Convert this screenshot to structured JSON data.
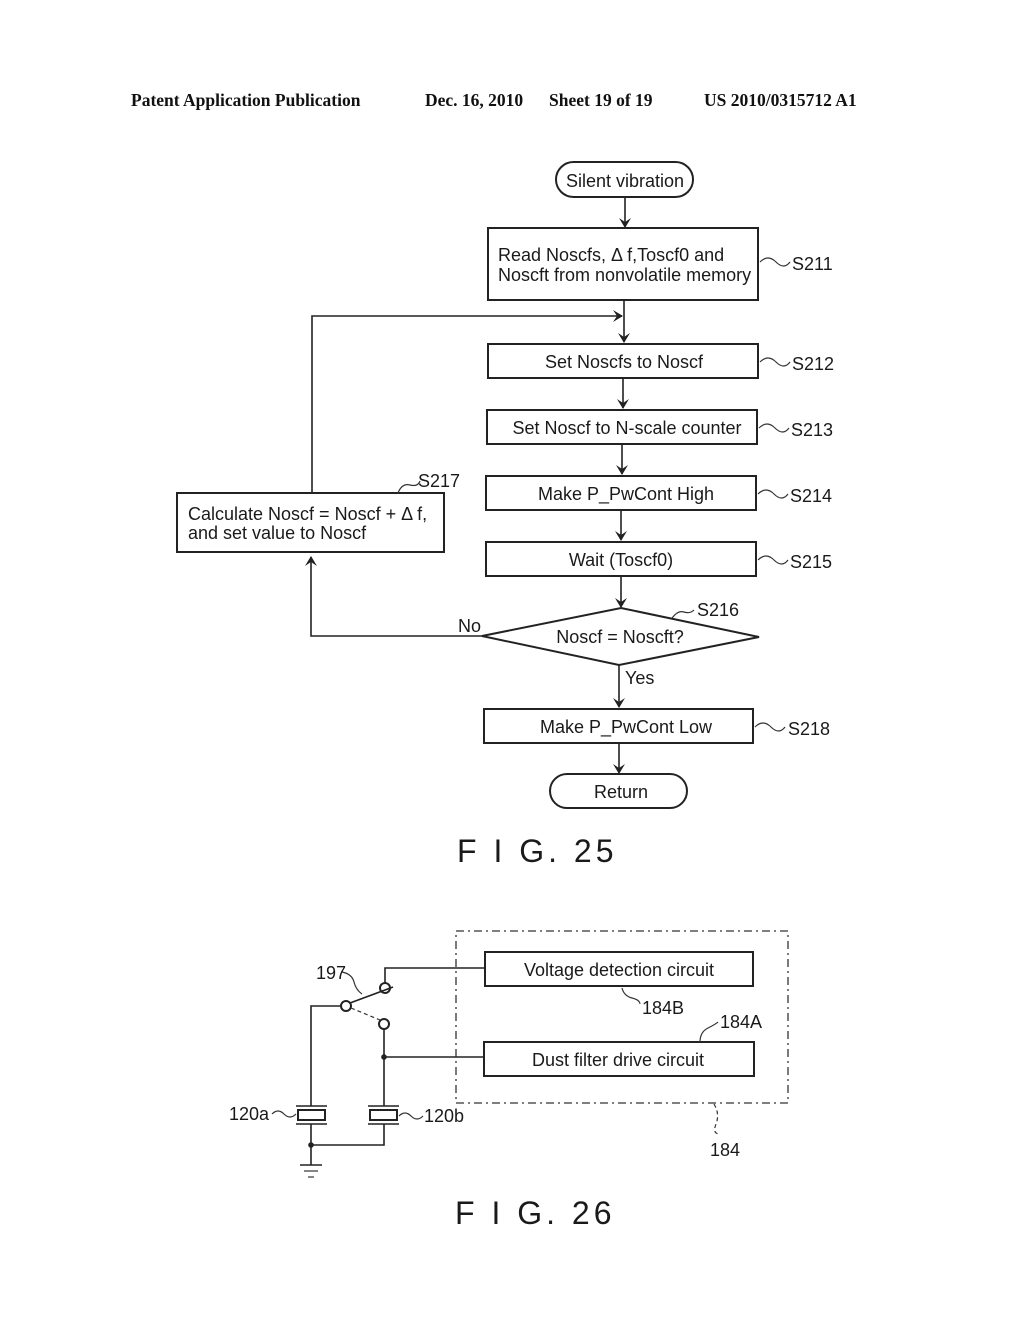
{
  "header": {
    "publication": "Patent Application Publication",
    "date": "Dec. 16, 2010",
    "sheet": "Sheet 19 of 19",
    "number": "US 2010/0315712 A1"
  },
  "fig25": {
    "caption": "F I G. 25",
    "start": "Silent vibration",
    "end": "Return",
    "steps": [
      {
        "id": "S211",
        "lines": [
          "Read Noscfs, Δ f,Toscf0 and",
          "Noscft from nonvolatile memory"
        ]
      },
      {
        "id": "S212",
        "lines": [
          "Set Noscfs to Noscf"
        ]
      },
      {
        "id": "S213",
        "lines": [
          "Set Noscf to N-scale counter"
        ]
      },
      {
        "id": "S214",
        "lines": [
          "Make P_PwCont High"
        ]
      },
      {
        "id": "S215",
        "lines": [
          "Wait (Toscf0)"
        ]
      },
      {
        "id": "S216",
        "lines": [
          "Noscf = Noscft?"
        ]
      },
      {
        "id": "S217",
        "lines": [
          "Calculate Noscf = Noscf + Δ f,",
          "and set value to Noscf"
        ]
      },
      {
        "id": "S218",
        "lines": [
          "Make P_PwCont Low"
        ]
      }
    ],
    "branch_no": "No",
    "branch_yes": "Yes"
  },
  "fig26": {
    "caption": "F I G. 26",
    "voltage_circuit": "Voltage detection circuit",
    "drive_circuit": "Dust filter drive circuit",
    "ref_184B": "184B",
    "ref_184A": "184A",
    "ref_184": "184",
    "ref_197": "197",
    "ref_120a": "120a",
    "ref_120b": "120b"
  }
}
